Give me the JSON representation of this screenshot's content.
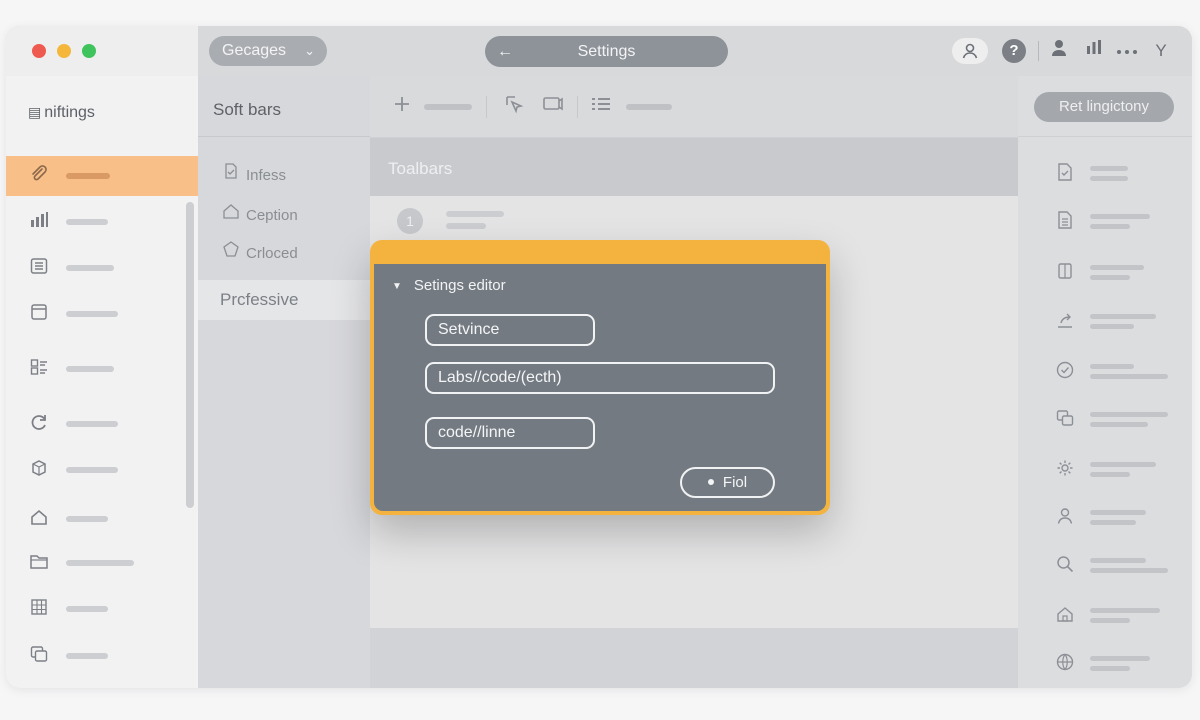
{
  "titlebar": {
    "dropdown_label": "Gecages",
    "dropdown_chevron": "⌄",
    "center_title": "Settings",
    "back_glyph": "←",
    "help_glyph": "?",
    "y_glyph": "Y"
  },
  "sidebar": {
    "heading": "niftings",
    "items": [
      {
        "icon": "paperclip-icon",
        "active": true
      },
      {
        "icon": "bar-chart-icon"
      },
      {
        "icon": "list-icon"
      },
      {
        "icon": "window-icon"
      },
      {
        "icon": "checklist-icon"
      },
      {
        "icon": "refresh-icon"
      },
      {
        "icon": "cube-icon"
      },
      {
        "icon": "home-icon"
      },
      {
        "icon": "folder-icon"
      },
      {
        "icon": "grid-icon"
      },
      {
        "icon": "layers-icon"
      }
    ]
  },
  "col2": {
    "heading": "Soft bars",
    "items": [
      {
        "label": "Infess",
        "icon": "document-icon"
      },
      {
        "label": "Ception",
        "icon": "home-icon"
      },
      {
        "label": "Crloced",
        "icon": "pentagon-icon"
      }
    ],
    "active_item": "Prcfessive"
  },
  "main": {
    "section_title": "Toalbars",
    "row_number": "1"
  },
  "right_panel": {
    "button_label": "Ret lingictony",
    "items": [
      {
        "icon": "file-check-icon"
      },
      {
        "icon": "file-text-icon"
      },
      {
        "icon": "columns-icon"
      },
      {
        "icon": "share-icon"
      },
      {
        "icon": "check-circle-icon"
      },
      {
        "icon": "copy-icon"
      },
      {
        "icon": "gear-icon"
      },
      {
        "icon": "user-icon"
      },
      {
        "icon": "search-icon"
      },
      {
        "icon": "home-icon"
      },
      {
        "icon": "globe-icon"
      }
    ]
  },
  "modal": {
    "title": "Setings editor",
    "field1": "Setvince",
    "field2": "Labs//code/(ecth)",
    "field3": "code//linne",
    "button": "Fiol"
  },
  "colors": {
    "accent": "#f4b33e",
    "active_item": "#f9bf88",
    "modal_body": "#737a82"
  }
}
